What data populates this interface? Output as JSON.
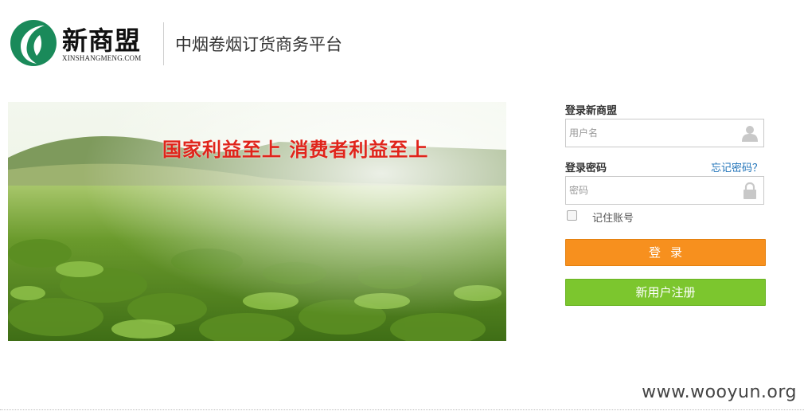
{
  "header": {
    "logo_name": "新商盟",
    "logo_sub": "XINSHANGMENG.COM",
    "platform_title": "中烟卷烟订货商务平台"
  },
  "banner": {
    "slogan": "国家利益至上  消费者利益至上"
  },
  "login": {
    "title": "登录新商盟",
    "username_placeholder": "用户名",
    "password_label": "登录密码",
    "forgot_link": "忘记密码？",
    "password_placeholder": "密码",
    "remember_label": "记住账号",
    "remember_checked": false,
    "login_button": "登录",
    "register_button": "新用户注册",
    "login_color": "#f7901e",
    "register_color": "#7cc62e",
    "link_color": "#1e72b8"
  },
  "icons": {
    "user": "user-icon",
    "lock": "lock-icon",
    "logo": "leaf-logo-icon"
  },
  "watermark": "www.wooyun.org"
}
